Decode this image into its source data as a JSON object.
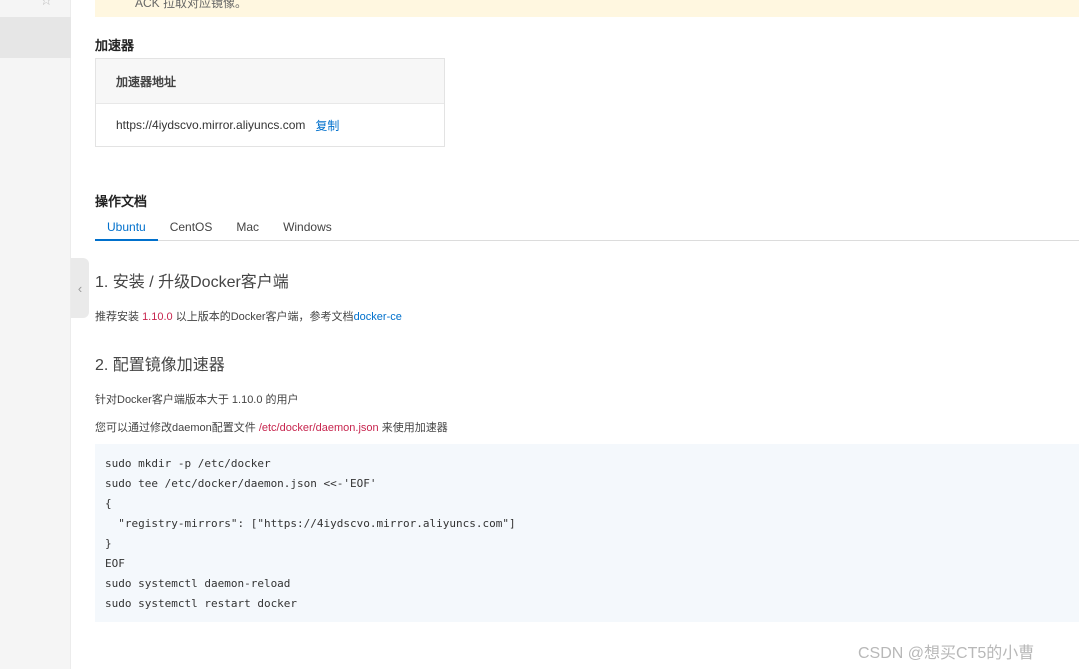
{
  "notice": {
    "text": "ACK 拉取对应镜像。"
  },
  "accelerator": {
    "section_title": "加速器",
    "header": "加速器地址",
    "address": "https://4iydscvo.mirror.aliyuncs.com",
    "copy_label": "复制"
  },
  "docs": {
    "section_title": "操作文档",
    "tabs": [
      {
        "label": "Ubuntu",
        "active": true
      },
      {
        "label": "CentOS",
        "active": false
      },
      {
        "label": "Mac",
        "active": false
      },
      {
        "label": "Windows",
        "active": false
      }
    ],
    "step1": {
      "title": "1. 安装 / 升级Docker客户端",
      "text_prefix": "推荐安装 ",
      "version": "1.10.0",
      "text_middle": " 以上版本的Docker客户端，参考文档",
      "link": "docker-ce"
    },
    "step2": {
      "title": "2. 配置镜像加速器",
      "line1": "针对Docker客户端版本大于 1.10.0 的用户",
      "line2_prefix": "您可以通过修改daemon配置文件 ",
      "config_path": "/etc/docker/daemon.json",
      "line2_suffix": " 来使用加速器"
    },
    "code_lines": [
      "sudo mkdir -p /etc/docker",
      "sudo tee /etc/docker/daemon.json <<-'EOF'",
      "{",
      "  \"registry-mirrors\": [\"https://4iydscvo.mirror.aliyuncs.com\"]",
      "}",
      "EOF",
      "sudo systemctl daemon-reload",
      "sudo systemctl restart docker"
    ]
  },
  "watermark": "CSDN @想买CT5的小曹",
  "colors": {
    "accent": "#0070cc",
    "highlight": "#c7254e",
    "code_bg": "#f4f8fc",
    "notice_bg": "#fff7e0"
  }
}
